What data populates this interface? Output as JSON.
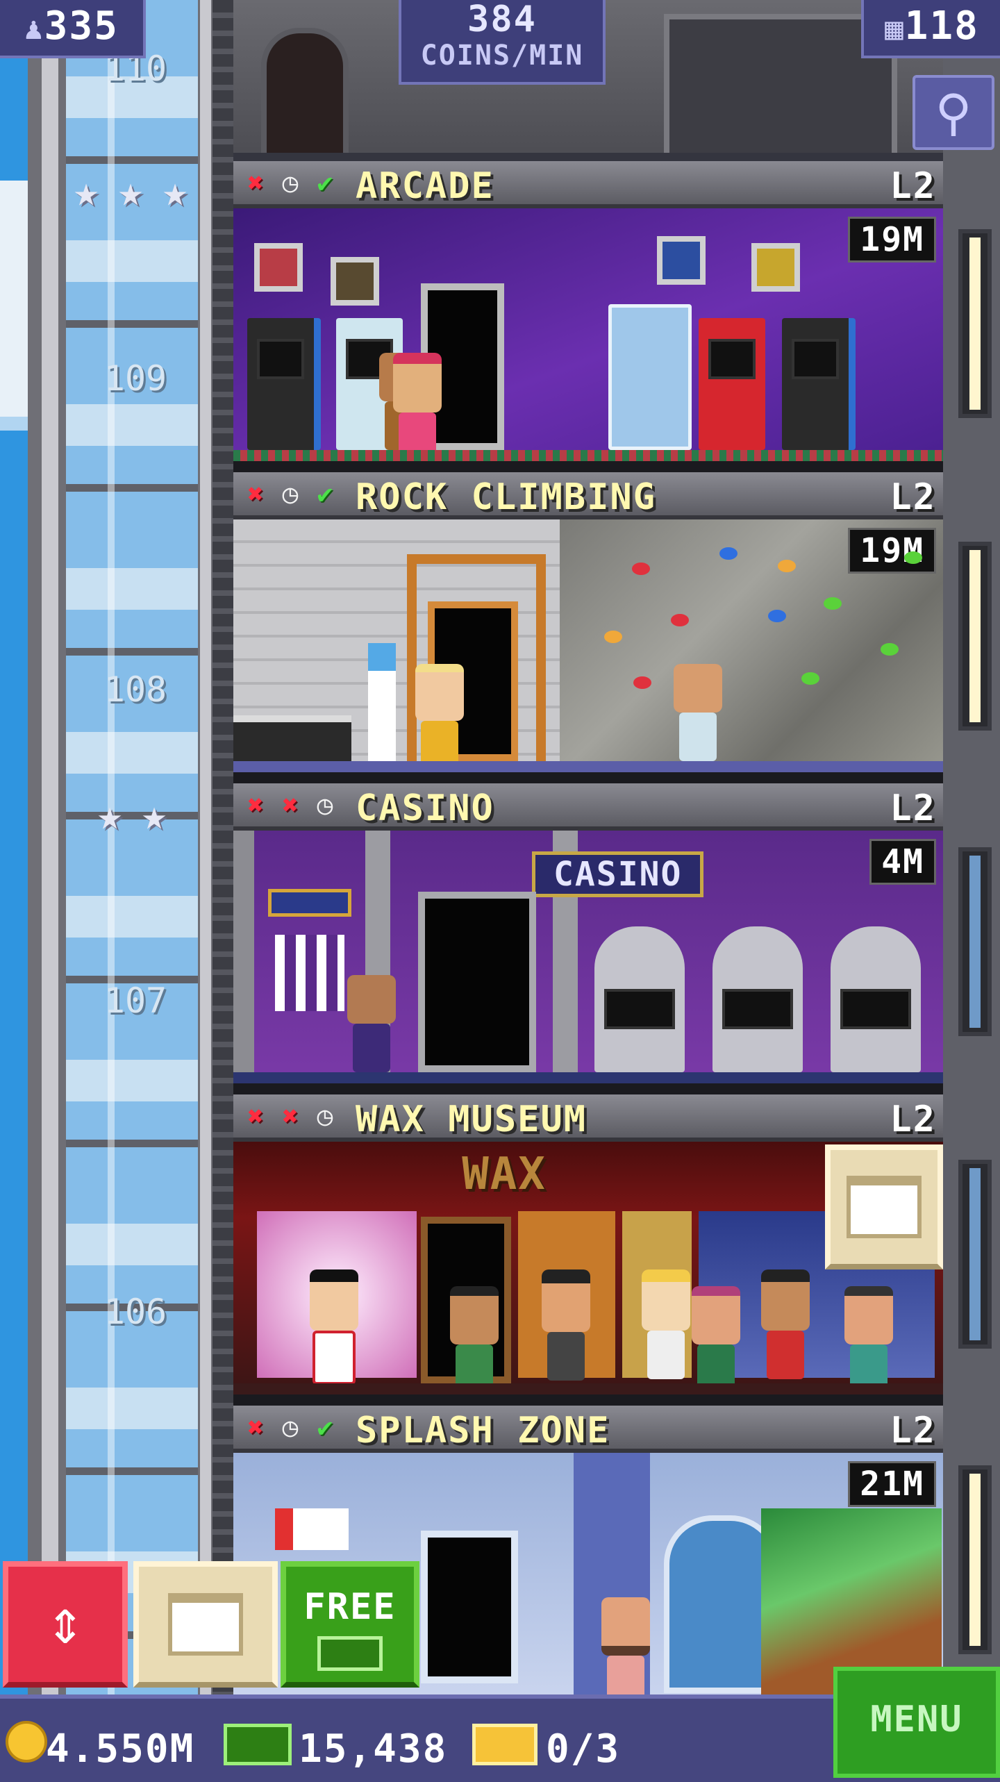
{
  "hud": {
    "population": "335",
    "coins_rate_value": "384",
    "coins_rate_label": "COINS/MIN",
    "floor_count": "118"
  },
  "shaft": {
    "floor_numbers": [
      "110",
      "109",
      "108",
      "107",
      "106"
    ]
  },
  "floors": [
    {
      "name": "ARCADE",
      "level": "L2",
      "earnings": "19M",
      "status": [
        "x-icon",
        "clock-icon",
        "check-icon"
      ],
      "stars": 3
    },
    {
      "name": "ROCK CLIMBING",
      "level": "L2",
      "earnings": "19M",
      "status": [
        "x-icon",
        "clock-icon",
        "check-icon"
      ],
      "stars": 0
    },
    {
      "name": "CASINO",
      "level": "L2",
      "earnings": "4M",
      "status": [
        "x-icon",
        "x-icon",
        "clock-icon"
      ],
      "stars": 2,
      "sign": "CASINO"
    },
    {
      "name": "WAX MUSEUM",
      "level": "L2",
      "earnings": "",
      "status": [
        "x-icon",
        "x-icon",
        "clock-icon"
      ],
      "stars": 0,
      "sign": "WAX"
    },
    {
      "name": "SPLASH ZONE",
      "level": "L2",
      "earnings": "21M",
      "status": [
        "x-icon",
        "clock-icon",
        "check-icon"
      ],
      "stars": 0
    }
  ],
  "controls": {
    "free_label": "FREE",
    "menu_label": "MENU"
  },
  "resources": {
    "coins": "4.550M",
    "tower_bux": "15,438",
    "tickets": "0/3"
  },
  "colors": {
    "hud_panel": "#3e3f7a",
    "title_text": "#fff8b0",
    "elevator_button": "#e6304a",
    "free_button": "#39a01a",
    "menu_button": "#2e9e22"
  }
}
